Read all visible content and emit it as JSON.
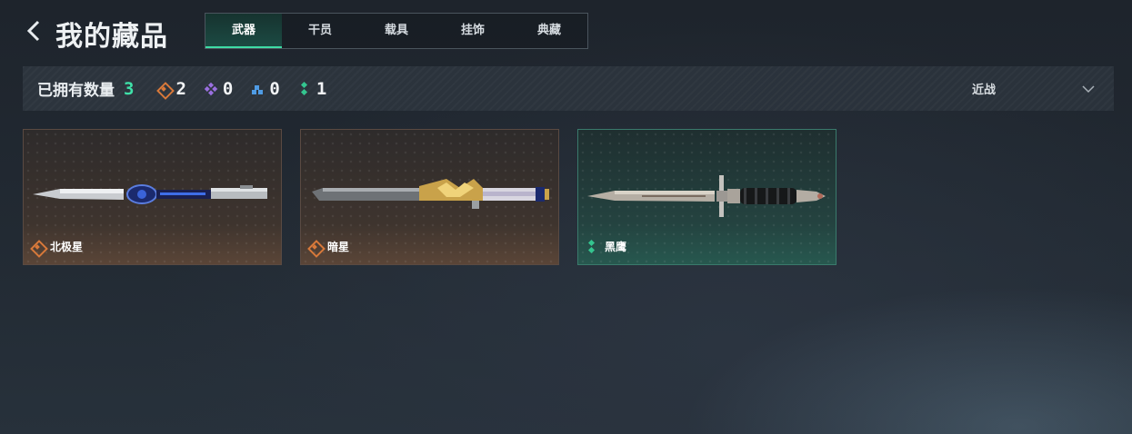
{
  "header": {
    "title": "我的藏品",
    "back_icon": "chevron-left-icon"
  },
  "tabs": [
    {
      "label": "武器",
      "active": true
    },
    {
      "label": "干员",
      "active": false
    },
    {
      "label": "载具",
      "active": false
    },
    {
      "label": "挂饰",
      "active": false
    },
    {
      "label": "典藏",
      "active": false
    }
  ],
  "summary": {
    "owned_label": "已拥有数量",
    "owned_count": "3",
    "rarity_counts": [
      {
        "icon": "orange-diamond-icon",
        "color": "#d8793a",
        "count": "2"
      },
      {
        "icon": "purple-diamond-icon",
        "color": "#9a6fe0",
        "count": "0"
      },
      {
        "icon": "blue-diamond-icon",
        "color": "#4f9be4",
        "count": "0"
      },
      {
        "icon": "green-dots-icon",
        "color": "#34c58f",
        "count": "1"
      }
    ],
    "filter": {
      "selected": "近战",
      "icon": "chevron-down-icon"
    }
  },
  "items": [
    {
      "name": "北极星",
      "rarity_icon": "orange-diamond-icon",
      "rarity_color": "#d8793a"
    },
    {
      "name": "暗星",
      "rarity_icon": "orange-diamond-icon",
      "rarity_color": "#d8793a"
    },
    {
      "name": "黑鹰",
      "rarity_icon": "green-dots-icon",
      "rarity_color": "#34c58f"
    }
  ],
  "colors": {
    "accent": "#3fdca5",
    "background": "#222a33"
  }
}
